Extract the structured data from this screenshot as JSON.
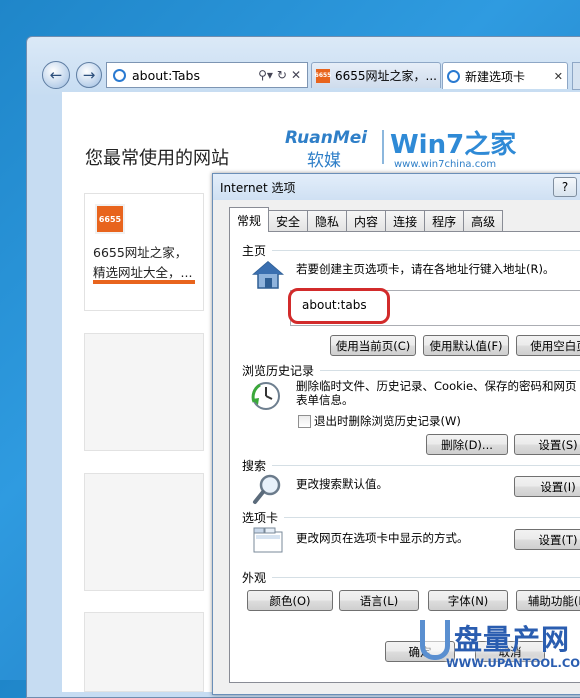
{
  "browser": {
    "address": "about:Tabs",
    "tabs": [
      {
        "label": "6655网址之家，..."
      },
      {
        "label": "新建选项卡"
      }
    ]
  },
  "page": {
    "title": "您最常使用的网站",
    "tile1": {
      "line1": "6655网址之家，",
      "line2": "精选网址大全，...",
      "favicon": "6655"
    },
    "logo": {
      "ruanmei": "RuanMei",
      "ruanmei_cn": "软媒",
      "win7": "Win7之家",
      "url": "www.win7china.com"
    }
  },
  "dialog": {
    "title": "Internet 选项",
    "help": "?",
    "tabs": [
      "常规",
      "安全",
      "隐私",
      "内容",
      "连接",
      "程序",
      "高级"
    ],
    "homepage": {
      "group": "主页",
      "desc": "若要创建主页选项卡，请在各地址行键入地址(R)。",
      "value": "about:tabs",
      "buttons": [
        "使用当前页(C)",
        "使用默认值(F)",
        "使用空白页"
      ]
    },
    "history": {
      "group": "浏览历史记录",
      "desc1": "删除临时文件、历史记录、Cookie、保存的密码和网页",
      "desc2": "表单信息。",
      "checkbox": "退出时删除浏览历史记录(W)",
      "buttons": [
        "删除(D)...",
        "设置(S)"
      ]
    },
    "search": {
      "group": "搜索",
      "desc": "更改搜索默认值。",
      "button": "设置(I)"
    },
    "tabsgrp": {
      "group": "选项卡",
      "desc": "更改网页在选项卡中显示的方式。",
      "button": "设置(T)"
    },
    "appearance": {
      "group": "外观",
      "buttons": [
        "颜色(O)",
        "语言(L)",
        "字体(N)",
        "辅助功能(E)"
      ]
    },
    "footer": {
      "ok": "确定",
      "cancel": "取消"
    }
  },
  "watermark": {
    "brand": "盘量产网",
    "url": "WWW.UPANTOOL.COM"
  }
}
